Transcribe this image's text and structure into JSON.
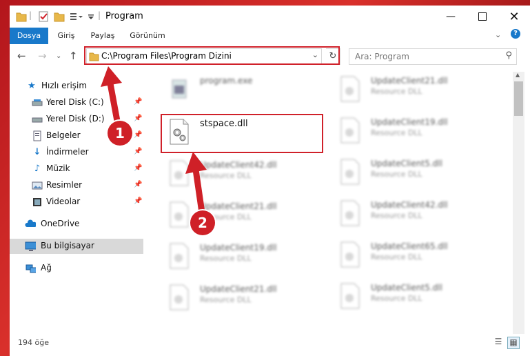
{
  "window": {
    "title": "Program"
  },
  "ribbon": {
    "tabs": [
      "Dosya",
      "Giriş",
      "Paylaş",
      "Görünüm"
    ]
  },
  "address": {
    "path": "C:\\Program Files\\Program Dizini"
  },
  "search": {
    "placeholder": "Ara: Program"
  },
  "sidebar": {
    "items": [
      {
        "label": "Hızlı erişim",
        "icon": "star-icon"
      },
      {
        "label": "Yerel Disk (C:)",
        "icon": "disk-icon"
      },
      {
        "label": "Yerel Disk (D:)",
        "icon": "disk-icon"
      },
      {
        "label": "Belgeler",
        "icon": "documents-icon"
      },
      {
        "label": "İndirmeler",
        "icon": "download-icon"
      },
      {
        "label": "Müzik",
        "icon": "music-icon"
      },
      {
        "label": "Resimler",
        "icon": "pictures-icon"
      },
      {
        "label": "Videolar",
        "icon": "video-icon"
      },
      {
        "label": "OneDrive",
        "icon": "cloud-icon"
      },
      {
        "label": "Bu bilgisayar",
        "icon": "computer-icon"
      },
      {
        "label": "Ağ",
        "icon": "network-icon"
      }
    ]
  },
  "files": {
    "left": [
      {
        "name": "program.exe",
        "type": ""
      },
      {
        "name": "stspace.dll",
        "type": ""
      },
      {
        "name": "UpdateClient42.dll",
        "type": "Resource DLL"
      },
      {
        "name": "UpdateClient21.dll",
        "type": "Resource DLL"
      },
      {
        "name": "UpdateClient19.dll",
        "type": "Resource DLL"
      },
      {
        "name": "UpdateClient21.dll",
        "type": "Resource DLL"
      }
    ],
    "right": [
      {
        "name": "UpdateClient21.dll",
        "type": "Resource DLL"
      },
      {
        "name": "UpdateClient19.dll",
        "type": "Resource DLL"
      },
      {
        "name": "UpdateClient5.dll",
        "type": "Resource DLL"
      },
      {
        "name": "UpdateClient42.dll",
        "type": "Resource DLL"
      },
      {
        "name": "UpdateClient65.dll",
        "type": "Resource DLL"
      },
      {
        "name": "UpdateClient5.dll",
        "type": "Resource DLL"
      }
    ]
  },
  "status": {
    "count": "194 öğe"
  },
  "annotations": {
    "badge1": "1",
    "badge2": "2"
  },
  "colors": {
    "accent": "#1979ca",
    "highlight": "#d0212a",
    "selected": "#cce4f7"
  }
}
